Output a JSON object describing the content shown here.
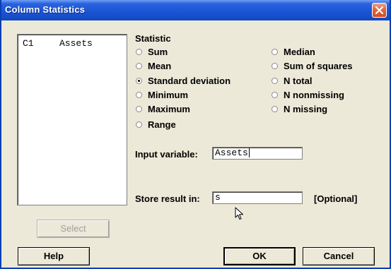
{
  "window": {
    "title": "Column Statistics"
  },
  "variables_list": {
    "items": [
      {
        "id": "C1",
        "name": "Assets"
      }
    ]
  },
  "statistic": {
    "label": "Statistic",
    "options": [
      {
        "label": "Sum",
        "selected": false
      },
      {
        "label": "Mean",
        "selected": false
      },
      {
        "label": "Standard deviation",
        "selected": true
      },
      {
        "label": "Minimum",
        "selected": false
      },
      {
        "label": "Maximum",
        "selected": false
      },
      {
        "label": "Range",
        "selected": false
      },
      {
        "label": "Median",
        "selected": false
      },
      {
        "label": "Sum of squares",
        "selected": false
      },
      {
        "label": "N total",
        "selected": false
      },
      {
        "label": "N nonmissing",
        "selected": false
      },
      {
        "label": "N missing",
        "selected": false
      }
    ]
  },
  "input_variable": {
    "label": "Input variable:",
    "value": "Assets"
  },
  "store_result": {
    "label": "Store result in:",
    "value": "s",
    "optional_note": "[Optional]"
  },
  "buttons": {
    "select": "Select",
    "help": "Help",
    "ok": "OK",
    "cancel": "Cancel"
  },
  "colors": {
    "titlebar": "#1a55d6",
    "dialog_background": "#ece9d8",
    "close_button": "#e06a44"
  }
}
